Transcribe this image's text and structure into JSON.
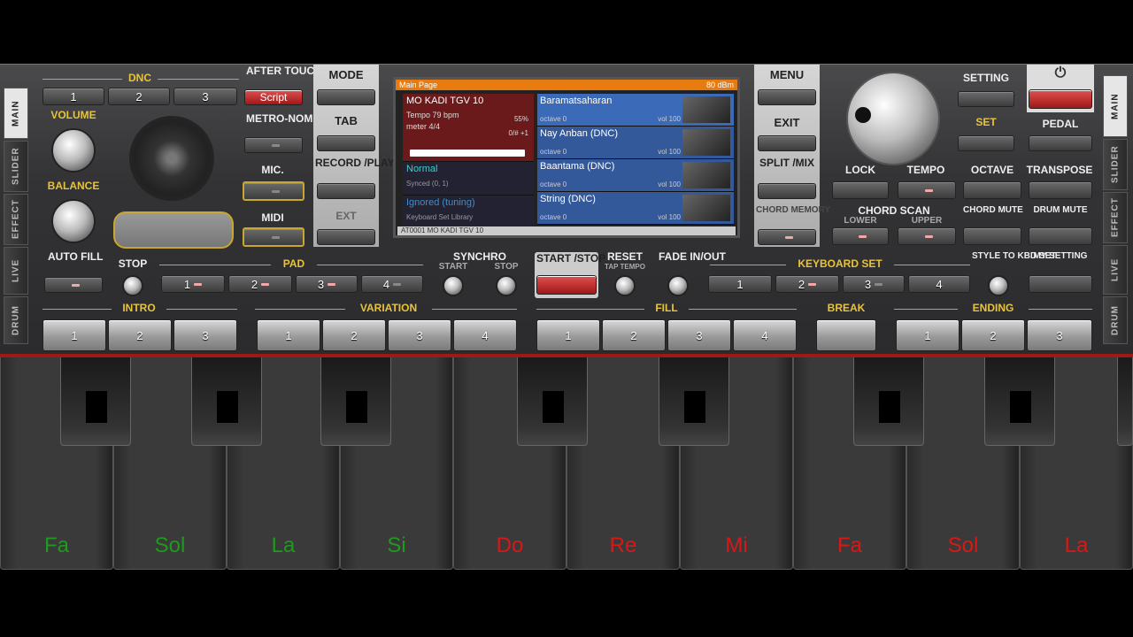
{
  "side_left": [
    "MAIN",
    "SLIDER",
    "EFFECT",
    "LIVE",
    "DRUM"
  ],
  "side_right": [
    "MAIN",
    "SLIDER",
    "EFFECT",
    "LIVE",
    "DRUM"
  ],
  "dnc": {
    "label": "DNC",
    "buttons": [
      "1",
      "2",
      "3"
    ]
  },
  "after_touch": {
    "label": "AFTER TOUCH",
    "value": "Script"
  },
  "volume_label": "VOLUME",
  "balance_label": "BALANCE",
  "auto_fill_label": "AUTO FILL",
  "stop_label": "STOP",
  "metronome_label": "METRO-NOME",
  "mic_label": "MIC.",
  "midi_label": "MIDI",
  "mode": {
    "mode": "MODE",
    "tab": "TAB",
    "record": "RECORD /PLAY",
    "ext": "EXT"
  },
  "screen": {
    "header_left": "Main Page",
    "header_right": "80 dBm",
    "style_name": "MO KADI TGV 10",
    "tempo": "Tempo 79 bpm",
    "tempo_pct": "55%",
    "meter": "meter 4/4",
    "meter_r": "0/# +1",
    "left_rows": [
      {
        "title": "Normal",
        "sub": "Synced (0, 1)"
      },
      {
        "title": "Ignored (tuning)",
        "sub": "Keyboard Set Library"
      }
    ],
    "tracks": [
      {
        "name": "Baramatsaharan",
        "sub": "octave 0",
        "vol": "vol 100"
      },
      {
        "name": "Nay Anban (DNC)",
        "sub": "octave 0",
        "vol": "vol 100"
      },
      {
        "name": "Baantama (DNC)",
        "sub": "octave 0",
        "vol": "vol 100"
      },
      {
        "name": "String (DNC)",
        "sub": "octave 0",
        "vol": "vol 100"
      }
    ],
    "footer": "AT0001 MO KADI TGV 10"
  },
  "right_mode": {
    "menu": "MENU",
    "exit": "EXIT",
    "split": "SPLIT /MIX",
    "chord_memory": "CHORD MEMORY"
  },
  "setting_label": "SETTING",
  "set_label": "SET",
  "pedal_label": "PEDAL",
  "lock_label": "LOCK",
  "tempo_label": "TEMPO",
  "octave_label": "OCTAVE",
  "transpose_label": "TRANSPOSE",
  "chord_scan": {
    "label": "CHORD SCAN",
    "lower": "LOWER",
    "upper": "UPPER"
  },
  "chord_mute_label": "CHORD MUTE",
  "drum_mute_label": "DRUM MUTE",
  "pad": {
    "label": "PAD",
    "buttons": [
      "1",
      "2",
      "3",
      "4"
    ]
  },
  "synchro": {
    "label": "SYNCHRO",
    "start": "START",
    "stop": "STOP"
  },
  "start_stop_label": "START /STOP",
  "reset_label": "RESET",
  "tap_tempo": "TAP TEMPO",
  "fade_label": "FADE IN/OUT",
  "keyboard_set": {
    "label": "KEYBOARD SET",
    "buttons": [
      "1",
      "2",
      "3",
      "4"
    ]
  },
  "style_to_kbd_label": "STYLE TO KBD SET",
  "my_setting_label": "MY SETTING",
  "intro": {
    "label": "INTRO",
    "buttons": [
      "1",
      "2",
      "3"
    ]
  },
  "variation": {
    "label": "VARIATION",
    "buttons": [
      "1",
      "2",
      "3",
      "4"
    ]
  },
  "fill": {
    "label": "FILL",
    "buttons": [
      "1",
      "2",
      "3",
      "4"
    ]
  },
  "break_label": "BREAK",
  "ending": {
    "label": "ENDING",
    "buttons": [
      "1",
      "2",
      "3"
    ]
  },
  "notes": [
    {
      "name": "Fa",
      "color": "#1f9a1f"
    },
    {
      "name": "Sol",
      "color": "#1f9a1f"
    },
    {
      "name": "La",
      "color": "#1f9a1f"
    },
    {
      "name": "Si",
      "color": "#1f9a1f"
    },
    {
      "name": "Do",
      "color": "#d81818"
    },
    {
      "name": "Re",
      "color": "#d81818"
    },
    {
      "name": "Mi",
      "color": "#d81818"
    },
    {
      "name": "Fa",
      "color": "#d81818"
    },
    {
      "name": "Sol",
      "color": "#d81818"
    },
    {
      "name": "La",
      "color": "#d81818"
    }
  ],
  "colors": {
    "accent": "#e8c43a",
    "screen_header": "#e87b10",
    "active_red": "#c82828"
  }
}
